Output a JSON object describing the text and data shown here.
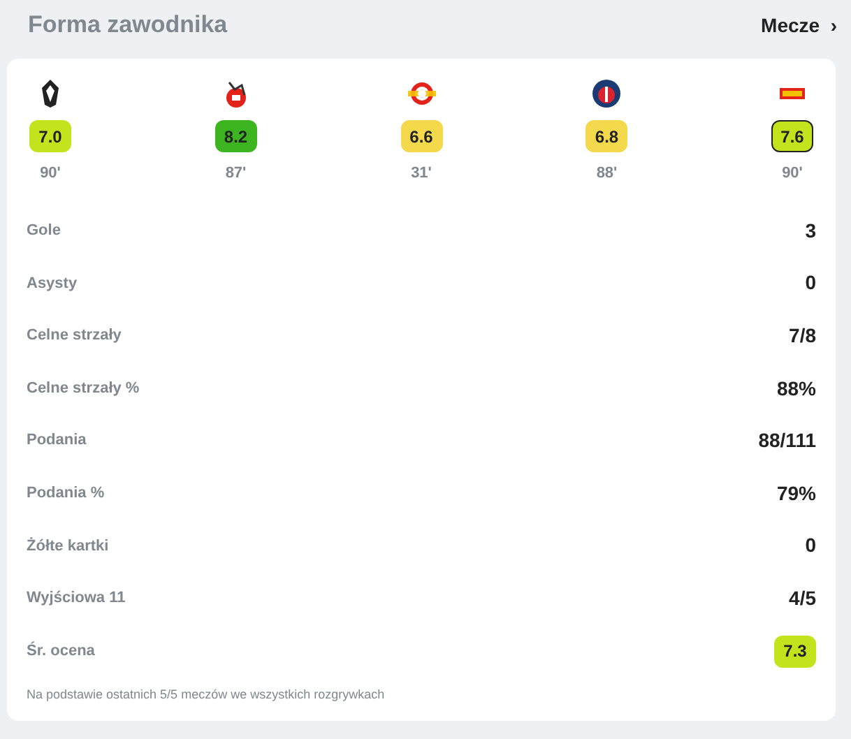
{
  "header": {
    "title": "Forma zawodnika",
    "link": "Mecze",
    "link_icon": "›"
  },
  "matches": [
    {
      "rating": "7.0",
      "minutes": "90'",
      "color": "#c3e31c",
      "selected": false
    },
    {
      "rating": "8.2",
      "minutes": "87'",
      "color": "#3cb521",
      "selected": false
    },
    {
      "rating": "6.6",
      "minutes": "31'",
      "color": "#f5d94c",
      "selected": false
    },
    {
      "rating": "6.8",
      "minutes": "88'",
      "color": "#f5d94c",
      "selected": false
    },
    {
      "rating": "7.6",
      "minutes": "90'",
      "color": "#c3e31c",
      "selected": true
    }
  ],
  "stats": [
    {
      "kind": "text",
      "label": "Gole",
      "value": "3"
    },
    {
      "kind": "text",
      "label": "Asysty",
      "value": "0"
    },
    {
      "kind": "text",
      "label": "Celne strzały",
      "value": "7/8"
    },
    {
      "kind": "text",
      "label": "Celne strzały %",
      "value": "88%"
    },
    {
      "kind": "text",
      "label": "Podania",
      "value": "88/111"
    },
    {
      "kind": "text",
      "label": "Podania %",
      "value": "79%"
    },
    {
      "kind": "text",
      "label": "Żółte kartki",
      "value": "0"
    },
    {
      "kind": "text",
      "label": "Wyjściowa 11",
      "value": "4/5"
    },
    {
      "kind": "rating",
      "label": "Śr. ocena",
      "value": "7.3",
      "color": "#c3e31c"
    }
  ],
  "footnote": "Na podstawie ostatnich 5/5 meczów we wszystkich rozgrywkach"
}
